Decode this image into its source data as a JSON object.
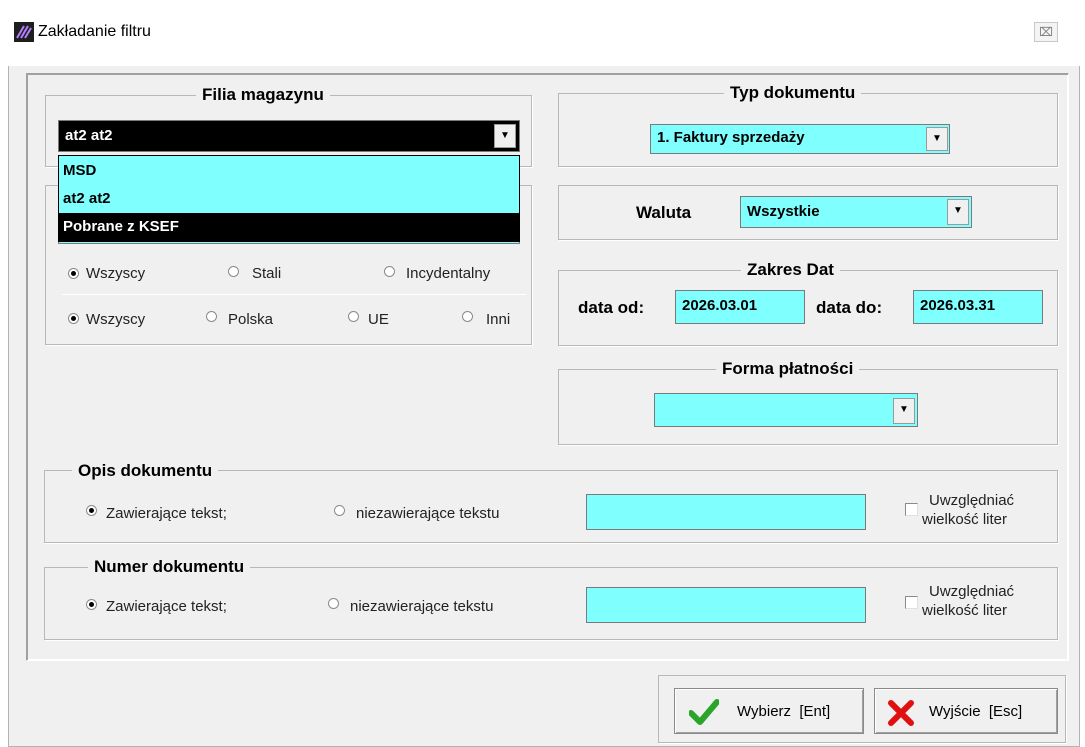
{
  "window": {
    "title": "Zakładanie filtru",
    "close_glyph": "⌧"
  },
  "filia": {
    "title": "Filia magazynu",
    "selected": "at2 at2",
    "options": [
      "MSD",
      "at2 at2",
      "Pobrane z KSEF"
    ]
  },
  "kontrahenci": {
    "row1": [
      "Wszyscy",
      "Stali",
      "Incydentalny"
    ],
    "row2": [
      "Wszyscy",
      "Polska",
      "UE",
      "Inni"
    ]
  },
  "typ": {
    "title": "Typ dokumentu",
    "selected": "1. Faktury sprzedaży"
  },
  "waluta": {
    "label": "Waluta",
    "selected": "Wszystkie"
  },
  "daty": {
    "title": "Zakres Dat",
    "from_label": "data od:",
    "from": "2026.03.01",
    "to_label": "data do:",
    "to": "2026.03.31"
  },
  "platnosc": {
    "title": "Forma płatności",
    "selected": ""
  },
  "opis": {
    "title": "Opis dokumentu",
    "opt1": "Zawierające tekst;",
    "opt2": "niezawierające tekstu",
    "value": "",
    "check1": "Uwzględniać",
    "check2": "wielkość liter"
  },
  "numer": {
    "title": "Numer dokumentu",
    "opt1": "Zawierające tekst;",
    "opt2": "niezawierające tekstu",
    "value": "",
    "check1": "Uwzględniać",
    "check2": "wielkość liter"
  },
  "buttons": {
    "ok": "Wybierz  [Ent]",
    "exit": "Wyjście  [Esc]"
  },
  "colors": {
    "field": "#80ffff",
    "ok_icon": "#2aa52a",
    "exit_icon": "#e01010"
  }
}
